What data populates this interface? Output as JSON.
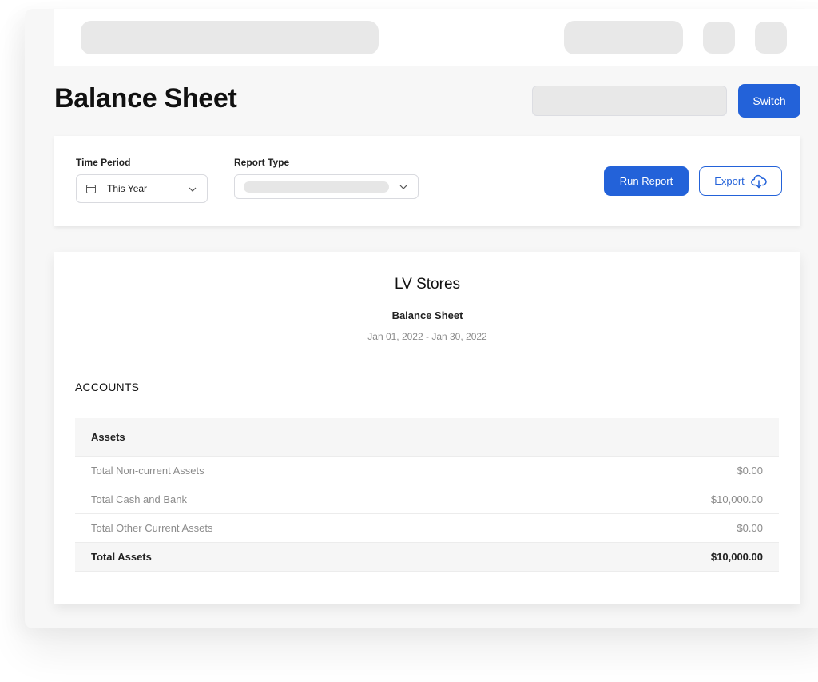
{
  "header": {
    "page_title": "Balance Sheet",
    "switch_label": "Switch"
  },
  "filters": {
    "time_period_label": "Time Period",
    "time_period_value": "This Year",
    "report_type_label": "Report Type",
    "run_report_label": "Run Report",
    "export_label": "Export"
  },
  "report": {
    "company": "LV Stores",
    "name": "Balance Sheet",
    "date_range": "Jan 01, 2022 - Jan 30, 2022",
    "section_title": "ACCOUNTS",
    "group_header": "Assets",
    "rows": [
      {
        "label": "Total Non-current Assets",
        "amount": "$0.00"
      },
      {
        "label": "Total Cash and Bank",
        "amount": "$10,000.00"
      },
      {
        "label": "Total Other Current Assets",
        "amount": "$0.00"
      }
    ],
    "total": {
      "label": "Total Assets",
      "amount": "$10,000.00"
    }
  },
  "colors": {
    "primary": "#2362d9",
    "background": "#f7f7f7",
    "skeleton": "#e8e8e8"
  }
}
